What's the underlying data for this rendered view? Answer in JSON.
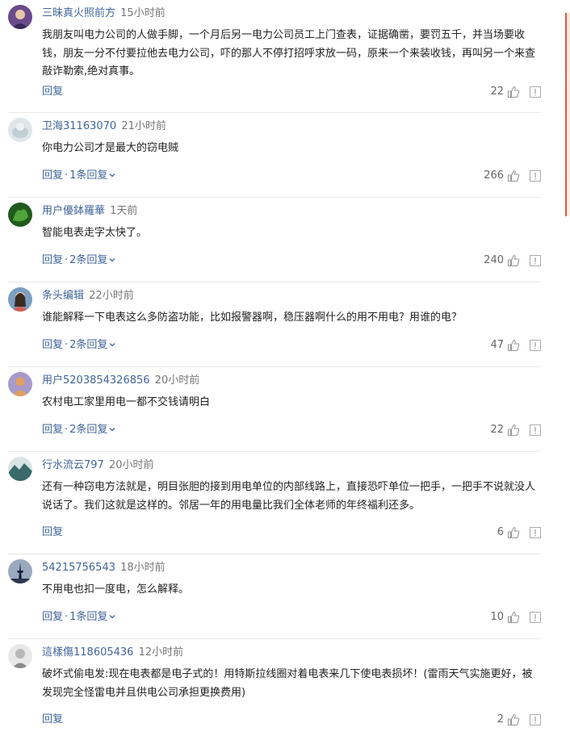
{
  "comments": [
    {
      "username": "三昧真火照前方",
      "time": "15小时前",
      "text": "我朋友叫电力公司的人做手脚，一个月后另一电力公司员工上门查表，证据确凿，要罚五千，并当场要收钱，朋友一分不付要拉他去电力公司，吓的那人不停打招呼求放一码，原来一个来装收钱，再叫另一个来查敲诈勒索,绝对真事。",
      "reply": "回复",
      "reply_count": "",
      "likes": "22",
      "avatar_color": "#6a4a8a"
    },
    {
      "username": "卫海31163070",
      "time": "21小时前",
      "text": "你电力公司才是最大的窃电贼",
      "reply": "回复",
      "reply_count": "1条回复",
      "likes": "266",
      "avatar_color": "#c9d4db"
    },
    {
      "username": "用户優鉢羅華",
      "time": "1天前",
      "text": "智能电表走字太快了。",
      "reply": "回复",
      "reply_count": "2条回复",
      "likes": "240",
      "avatar_color": "#2f7a2a"
    },
    {
      "username": "条头编辑",
      "time": "22小时前",
      "text": "谁能解释一下电表这么多防盗功能，比如报警器啊，稳压器啊什么的用不用电？用谁的电？",
      "reply": "回复",
      "reply_count": "2条回复",
      "likes": "47",
      "avatar_color": "#5a7aa0"
    },
    {
      "username": "用户5203854326856",
      "time": "20小时前",
      "text": "农村电工家里用电一都不交钱请明白",
      "reply": "回复",
      "reply_count": "2条回复",
      "likes": "22",
      "avatar_color": "#9a88c0"
    },
    {
      "username": "行水流云797",
      "time": "20小时前",
      "text": "还有一种窃电方法就是，明目张胆的接到用电单位的内部线路上，直接恐吓单位一把手，一把手不说就没人说话了。我们这就是这样的。邻居一年的用电量比我们全体老师的年终福利还多。",
      "reply": "回复",
      "reply_count": "",
      "likes": "6",
      "avatar_color": "#3a6a6a"
    },
    {
      "username": "54215756543",
      "time": "18小时前",
      "text": "不用电也扣一度电，怎么解释。",
      "reply": "回复",
      "reply_count": "1条回复",
      "likes": "10",
      "avatar_color": "#2a3550"
    },
    {
      "username": "這樣傷118605436",
      "time": "12小时前",
      "text": "破坏式偷电发:现在电表都是电子式的！用特斯拉线圈对着电表来几下使电表损坏！(雷雨天气实施更好，被发现完全怪雷电并且供电公司承担更换费用)",
      "reply": "回复",
      "reply_count": "",
      "likes": "2",
      "avatar_color": "#8a8a8a"
    }
  ],
  "colors": {
    "link": "#406599",
    "accent": "#e25a35"
  },
  "icons": {
    "like": "thumbs-up-icon",
    "report": "report-icon",
    "expand": "chevron-down-icon"
  }
}
